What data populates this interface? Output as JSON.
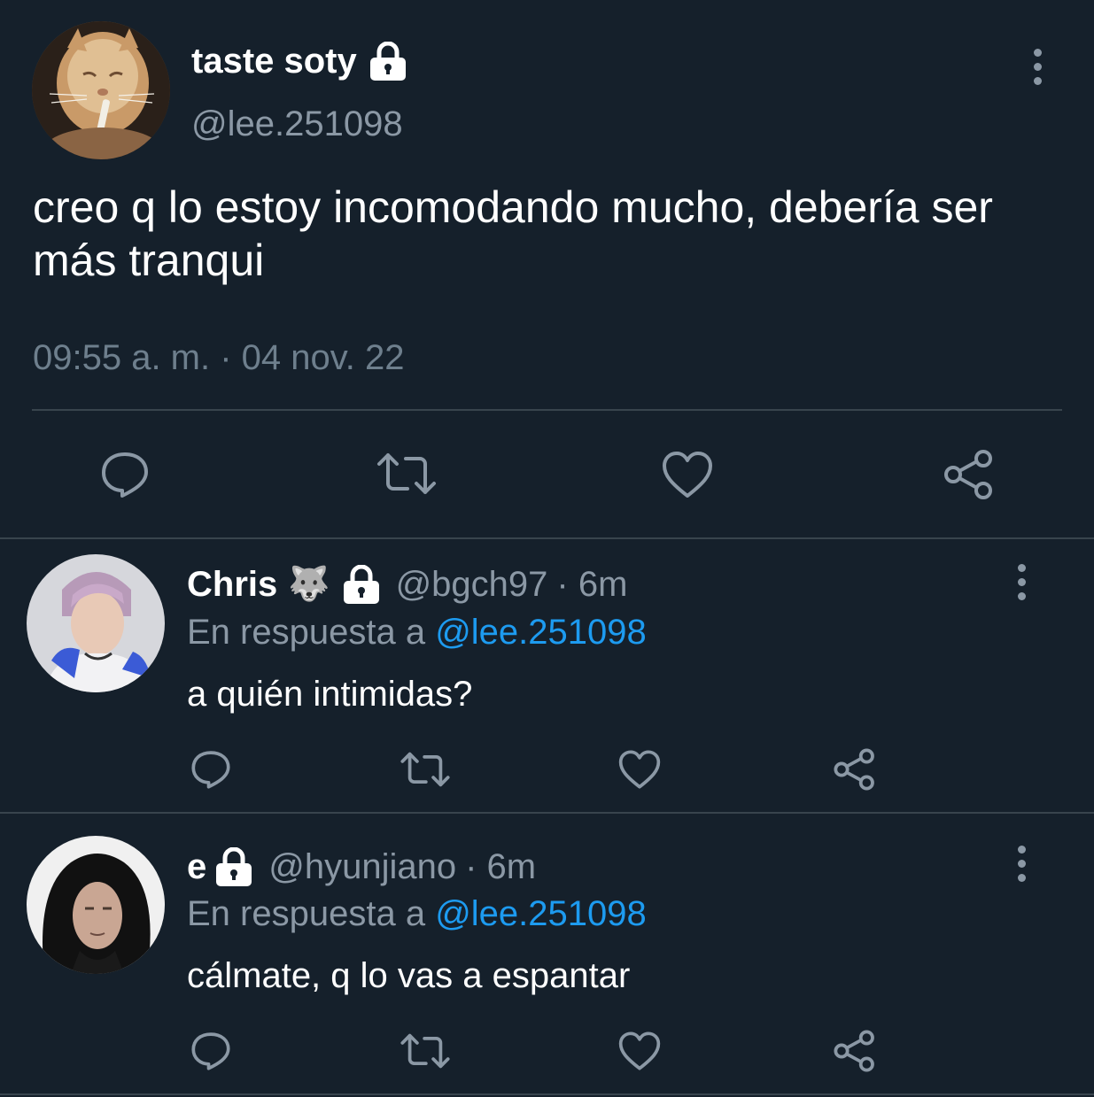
{
  "main_tweet": {
    "display_name": "taste soty",
    "handle": "@lee.251098",
    "text": "creo q lo estoy incomodando mucho, debería ser más tranqui",
    "timestamp": "09:55 a. m. · 04 nov. 22",
    "locked": true
  },
  "replies": [
    {
      "display_name": "Chris",
      "emoji": "🐺",
      "handle": "@bgch97",
      "time": "· 6m",
      "reply_prefix": "En respuesta a ",
      "reply_mention": "@lee.251098",
      "text": "a quién intimidas?",
      "locked": true
    },
    {
      "display_name": "e",
      "handle": "@hyunjiano",
      "time": "· 6m",
      "reply_prefix": "En respuesta a ",
      "reply_mention": "@lee.251098",
      "text": "cálmate, q lo vas a espantar",
      "locked": true
    }
  ],
  "icons": {
    "reply": "speech-bubble-icon",
    "retweet": "retweet-icon",
    "like": "heart-icon",
    "share": "share-icon",
    "more": "vertical-dots-icon",
    "lock": "lock-icon"
  },
  "colors": {
    "background": "#15202b",
    "text_primary": "#ffffff",
    "text_secondary": "#8b98a5",
    "accent": "#1d9bf0",
    "divider": "#38444d"
  }
}
